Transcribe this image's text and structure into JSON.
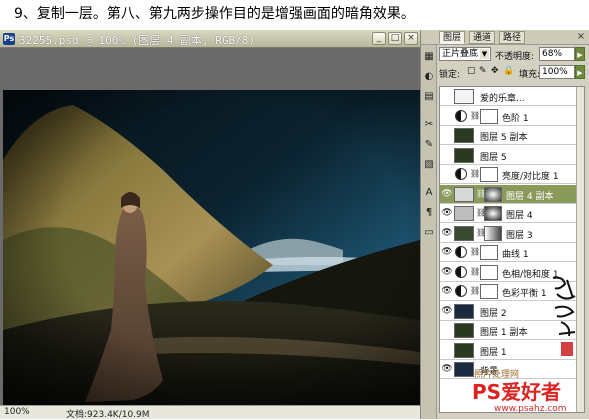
{
  "caption": "9、复制一层。第八、第九两步操作目的是增强画面的暗角效果。",
  "doc_window": {
    "title": "32255.psd @ 100% (图层 4 副本, RGB/8)",
    "status_zoom": "100%",
    "status_doc": "文档:923.4K/10.9M"
  },
  "layers_panel": {
    "tabs": [
      "图层",
      "通道",
      "路径"
    ],
    "close_label": "×",
    "blend_mode": "正片叠底",
    "opacity_label": "不透明度:",
    "opacity_value": "68%",
    "lock_label": "锁定:",
    "fill_label": "填充:",
    "fill_value": "100%",
    "layers": [
      {
        "name": "爱的乐章...",
        "visible": false,
        "kind": "image"
      },
      {
        "name": "色阶 1",
        "visible": false,
        "kind": "adjust"
      },
      {
        "name": "图层 5 副本",
        "visible": false,
        "kind": "image"
      },
      {
        "name": "图层 5",
        "visible": false,
        "kind": "image"
      },
      {
        "name": "亮度/对比度 1",
        "visible": false,
        "kind": "adjust"
      },
      {
        "name": "图层 4 副本",
        "visible": true,
        "kind": "image",
        "selected": true
      },
      {
        "name": "图层 4",
        "visible": true,
        "kind": "image"
      },
      {
        "name": "图层 3",
        "visible": true,
        "kind": "image"
      },
      {
        "name": "曲线 1",
        "visible": true,
        "kind": "adjust"
      },
      {
        "name": "色相/饱和度 1",
        "visible": true,
        "kind": "adjust"
      },
      {
        "name": "色彩平衡 1",
        "visible": true,
        "kind": "adjust"
      },
      {
        "name": "图层 2",
        "visible": true,
        "kind": "image"
      },
      {
        "name": "图层 1 副本",
        "visible": false,
        "kind": "image"
      },
      {
        "name": "图层 1",
        "visible": false,
        "kind": "image"
      },
      {
        "name": "背景",
        "visible": true,
        "kind": "image"
      }
    ]
  },
  "watermark": {
    "cn_text": "照片处理网",
    "logo_text": "PS爱好者",
    "url": "www.psahz.com"
  },
  "icons": {
    "eye": "eye-icon",
    "link": "chain-link-icon",
    "adjust": "adjustment-circle-icon"
  }
}
